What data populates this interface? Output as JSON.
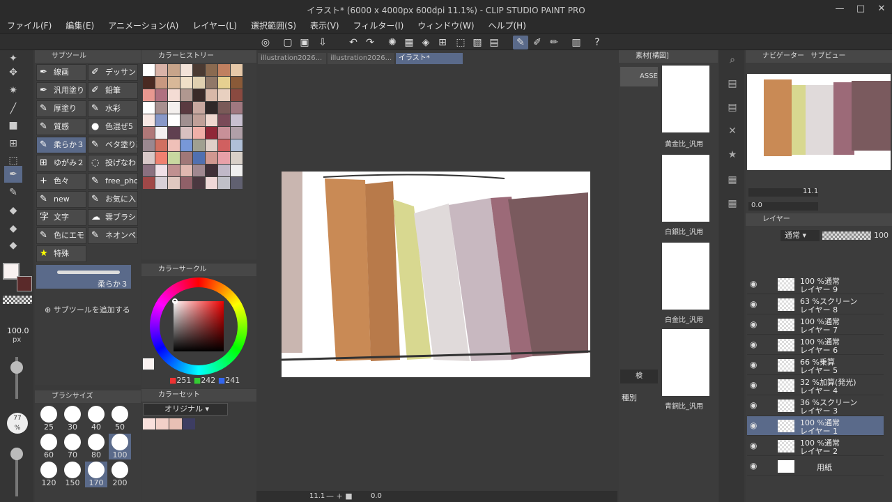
{
  "window": {
    "title": "イラスト* (6000 x 4000px 600dpi 11.1%) - CLIP STUDIO PAINT PRO"
  },
  "menu": [
    "ファイル(F)",
    "編集(E)",
    "アニメーション(A)",
    "レイヤー(L)",
    "選択範囲(S)",
    "表示(V)",
    "フィルター(I)",
    "ウィンドウ(W)",
    "ヘルプ(H)"
  ],
  "subtool": {
    "title": "サブツール",
    "items": [
      "線画",
      "デッサン",
      "汎用塗り",
      "鉛筆",
      "厚塗り",
      "水彩",
      "質感",
      "色混ぜ5",
      "柔らか３",
      "ベタ塗り系",
      "ゆがみ２",
      "投げなわ",
      "色々",
      "free_phot",
      "new",
      "お気に入",
      "文字",
      "雲ブラシ",
      "色にエモ",
      "ネオンペン",
      "特殊"
    ],
    "preview_label": "柔らか３",
    "add_label": "サブツールを追加する"
  },
  "history": {
    "title": "カラーヒストリー"
  },
  "wheel": {
    "title": "カラーサークル",
    "r": "251",
    "g": "242",
    "b": "241"
  },
  "brushsize": {
    "title": "ブラシサイズ",
    "sizes": [
      "25",
      "30",
      "40",
      "50",
      "60",
      "70",
      "80",
      "100",
      "120",
      "150",
      "170",
      "200"
    ]
  },
  "colorset": {
    "title": "カラーセット",
    "select": "オリジナル"
  },
  "tool_size": {
    "value": "100.0",
    "unit": "px",
    "opacity": "77",
    "opacity_unit": "%"
  },
  "tabs": [
    "illustration2026...",
    "illustration2026...",
    "イラスト*"
  ],
  "canvas_bar": {
    "zoom": "11.1",
    "angle": "0.0"
  },
  "material": {
    "title": "素材[構図]",
    "assets": "ASSE",
    "search": "検",
    "kind": "種別",
    "items": [
      "黄金比_汎用",
      "白銀比_汎用",
      "白金比_汎用",
      "青銅比_汎用"
    ]
  },
  "nav": {
    "title": "ナビゲーター",
    "sub": "サブビュー",
    "zoom": "11.1",
    "angle": "0.0"
  },
  "layers": {
    "title": "レイヤー",
    "blend": "通常",
    "opacity": "100",
    "rows": [
      {
        "mode": "100 %通常",
        "name": "レイヤー 9"
      },
      {
        "mode": "63 %スクリーン",
        "name": "レイヤー 8"
      },
      {
        "mode": "100 %通常",
        "name": "レイヤー 7"
      },
      {
        "mode": "100 %通常",
        "name": "レイヤー 6"
      },
      {
        "mode": "66 %乗算",
        "name": "レイヤー 5"
      },
      {
        "mode": "32 %加算(発光)",
        "name": "レイヤー 4"
      },
      {
        "mode": "36 %スクリーン",
        "name": "レイヤー 3"
      },
      {
        "mode": "100 %通常",
        "name": "レイヤー 1"
      },
      {
        "mode": "100 %通常",
        "name": "レイヤー 2"
      },
      {
        "mode": "",
        "name": "用紙"
      }
    ]
  },
  "colors": {
    "accent": "#5a6a8a",
    "main": "#f9f2f1",
    "sub": "#5a2a2a"
  }
}
